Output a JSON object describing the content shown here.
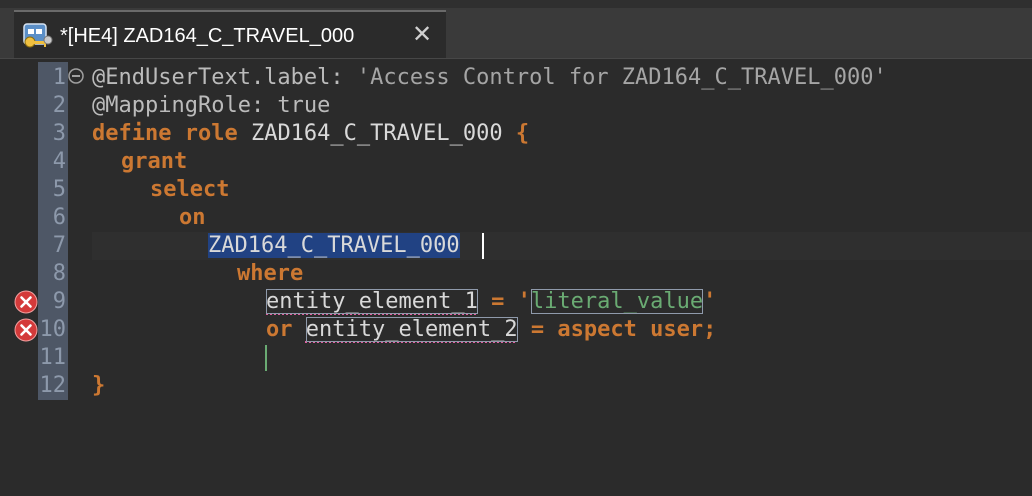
{
  "tab": {
    "title": "*[HE4] ZAD164_C_TRAVEL_000",
    "close_symbol": "✕",
    "icon": "access-control-icon"
  },
  "editor": {
    "line_numbers": [
      "1",
      "2",
      "3",
      "4",
      "5",
      "6",
      "7",
      "8",
      "9",
      "10",
      "11",
      "12"
    ],
    "lines": {
      "l1_a": "@EndUserText.label: ",
      "l1_b": "'Access Control for ZAD164_C_TRAVEL_000'",
      "l2": "@MappingRole: true",
      "l3_kw": "define role",
      "l3_name": " ZAD164_C_TRAVEL_000 ",
      "l3_brace": "{",
      "l4": "grant",
      "l5": "select",
      "l6": "on",
      "l7": "ZAD164_C_TRAVEL_000",
      "l8": "where",
      "l9_field": "entity_element_1",
      "l9_eq": " = ",
      "l9_q1": "'",
      "l9_val": "literal_value",
      "l9_q2": "'",
      "l10_or": "or ",
      "l10_field": "entity_element_2",
      "l10_rest": " = aspect user;",
      "l12": "}"
    },
    "error_lines": [
      "9",
      "10"
    ],
    "error_icon": "error-icon",
    "colors": {
      "keyword": "#cc7832",
      "annotation": "#bbbbbb",
      "selection": "#214283",
      "literal": "#6aab73",
      "gutter": "#4e5766",
      "background": "#2b2b2b"
    }
  }
}
